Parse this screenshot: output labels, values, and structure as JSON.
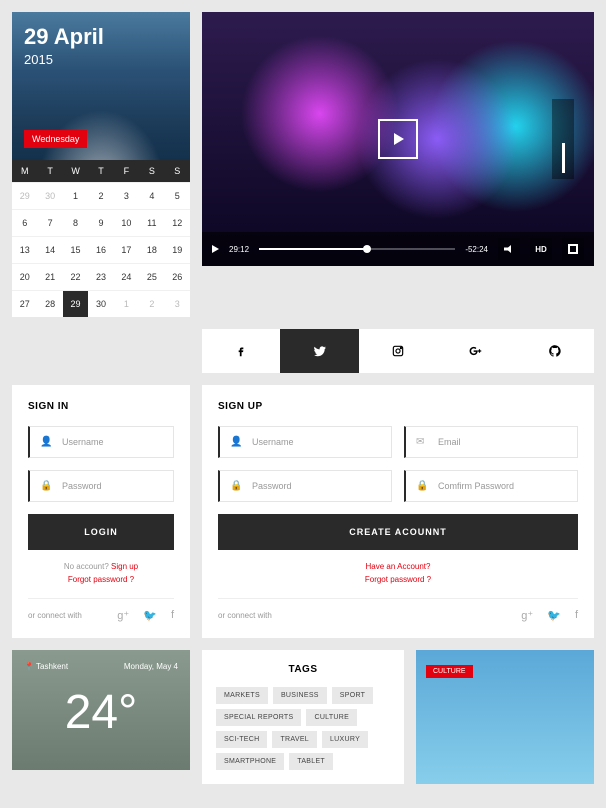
{
  "calendar": {
    "date": "29 April",
    "year": "2015",
    "badge": "Wednesday",
    "dayLabels": [
      "M",
      "T",
      "W",
      "T",
      "F",
      "S",
      "S"
    ],
    "weeks": [
      [
        {
          "n": "29",
          "muted": true
        },
        {
          "n": "30",
          "muted": true
        },
        {
          "n": "1"
        },
        {
          "n": "2"
        },
        {
          "n": "3"
        },
        {
          "n": "4"
        },
        {
          "n": "5"
        }
      ],
      [
        {
          "n": "6"
        },
        {
          "n": "7"
        },
        {
          "n": "8"
        },
        {
          "n": "9"
        },
        {
          "n": "10"
        },
        {
          "n": "11"
        },
        {
          "n": "12"
        }
      ],
      [
        {
          "n": "13"
        },
        {
          "n": "14"
        },
        {
          "n": "15"
        },
        {
          "n": "16"
        },
        {
          "n": "17"
        },
        {
          "n": "18"
        },
        {
          "n": "19"
        }
      ],
      [
        {
          "n": "20"
        },
        {
          "n": "21"
        },
        {
          "n": "22"
        },
        {
          "n": "23"
        },
        {
          "n": "24"
        },
        {
          "n": "25"
        },
        {
          "n": "26"
        }
      ],
      [
        {
          "n": "27"
        },
        {
          "n": "28"
        },
        {
          "n": "29",
          "active": true
        },
        {
          "n": "30"
        },
        {
          "n": "1",
          "muted": true
        },
        {
          "n": "2",
          "muted": true
        },
        {
          "n": "3",
          "muted": true
        }
      ]
    ]
  },
  "video": {
    "elapsed": "29:12",
    "remaining": "-52:24",
    "hd": "HD"
  },
  "signin": {
    "title": "SIGN IN",
    "username": "Username",
    "password": "Password",
    "button": "LOGIN",
    "noAccountLabel": "No account? ",
    "signup": "Sign up",
    "forgot": "Forgot password ?",
    "connect": "or connect with"
  },
  "signup": {
    "title": "SIGN UP",
    "username": "Username",
    "email": "Email",
    "password": "Password",
    "confirm": "Comfirm Password",
    "button": "CREATE ACOUNNT",
    "have": "Have an Account?",
    "forgot": "Forgot password ?",
    "connect": "or connect with"
  },
  "weather": {
    "location": "Tashkent",
    "day": "Monday, May 4",
    "temp": "24°"
  },
  "tags": {
    "title": "TAGS",
    "list": [
      "MARKETS",
      "BUSINESS",
      "SPORT",
      "SPECIAL REPORTS",
      "CULTURE",
      "SCI-TECH",
      "TRAVEL",
      "LUXURY",
      "SMARTPHONE",
      "TABLET"
    ]
  },
  "culture": {
    "badge": "CULTURE"
  }
}
